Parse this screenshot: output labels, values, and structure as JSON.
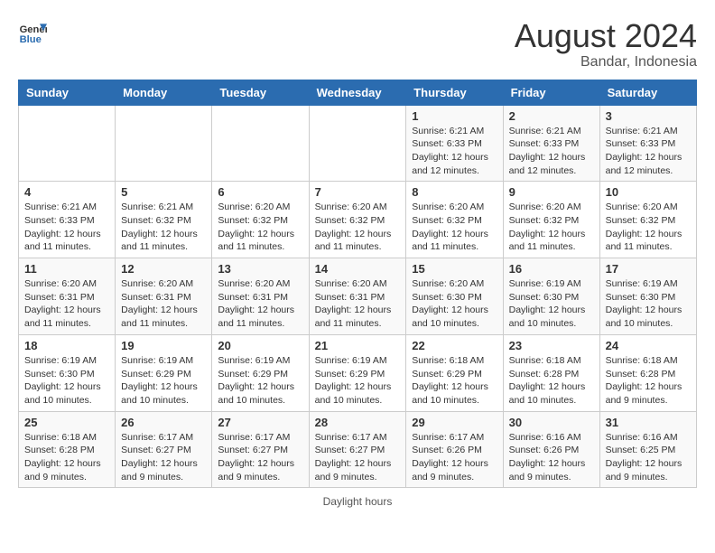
{
  "header": {
    "logo_text_general": "General",
    "logo_text_blue": "Blue",
    "month_year": "August 2024",
    "location": "Bandar, Indonesia"
  },
  "days_of_week": [
    "Sunday",
    "Monday",
    "Tuesday",
    "Wednesday",
    "Thursday",
    "Friday",
    "Saturday"
  ],
  "weeks": [
    [
      {
        "day": "",
        "info": ""
      },
      {
        "day": "",
        "info": ""
      },
      {
        "day": "",
        "info": ""
      },
      {
        "day": "",
        "info": ""
      },
      {
        "day": "1",
        "info": "Sunrise: 6:21 AM\nSunset: 6:33 PM\nDaylight: 12 hours and 12 minutes."
      },
      {
        "day": "2",
        "info": "Sunrise: 6:21 AM\nSunset: 6:33 PM\nDaylight: 12 hours and 12 minutes."
      },
      {
        "day": "3",
        "info": "Sunrise: 6:21 AM\nSunset: 6:33 PM\nDaylight: 12 hours and 12 minutes."
      }
    ],
    [
      {
        "day": "4",
        "info": "Sunrise: 6:21 AM\nSunset: 6:33 PM\nDaylight: 12 hours and 11 minutes."
      },
      {
        "day": "5",
        "info": "Sunrise: 6:21 AM\nSunset: 6:32 PM\nDaylight: 12 hours and 11 minutes."
      },
      {
        "day": "6",
        "info": "Sunrise: 6:20 AM\nSunset: 6:32 PM\nDaylight: 12 hours and 11 minutes."
      },
      {
        "day": "7",
        "info": "Sunrise: 6:20 AM\nSunset: 6:32 PM\nDaylight: 12 hours and 11 minutes."
      },
      {
        "day": "8",
        "info": "Sunrise: 6:20 AM\nSunset: 6:32 PM\nDaylight: 12 hours and 11 minutes."
      },
      {
        "day": "9",
        "info": "Sunrise: 6:20 AM\nSunset: 6:32 PM\nDaylight: 12 hours and 11 minutes."
      },
      {
        "day": "10",
        "info": "Sunrise: 6:20 AM\nSunset: 6:32 PM\nDaylight: 12 hours and 11 minutes."
      }
    ],
    [
      {
        "day": "11",
        "info": "Sunrise: 6:20 AM\nSunset: 6:31 PM\nDaylight: 12 hours and 11 minutes."
      },
      {
        "day": "12",
        "info": "Sunrise: 6:20 AM\nSunset: 6:31 PM\nDaylight: 12 hours and 11 minutes."
      },
      {
        "day": "13",
        "info": "Sunrise: 6:20 AM\nSunset: 6:31 PM\nDaylight: 12 hours and 11 minutes."
      },
      {
        "day": "14",
        "info": "Sunrise: 6:20 AM\nSunset: 6:31 PM\nDaylight: 12 hours and 11 minutes."
      },
      {
        "day": "15",
        "info": "Sunrise: 6:20 AM\nSunset: 6:30 PM\nDaylight: 12 hours and 10 minutes."
      },
      {
        "day": "16",
        "info": "Sunrise: 6:19 AM\nSunset: 6:30 PM\nDaylight: 12 hours and 10 minutes."
      },
      {
        "day": "17",
        "info": "Sunrise: 6:19 AM\nSunset: 6:30 PM\nDaylight: 12 hours and 10 minutes."
      }
    ],
    [
      {
        "day": "18",
        "info": "Sunrise: 6:19 AM\nSunset: 6:30 PM\nDaylight: 12 hours and 10 minutes."
      },
      {
        "day": "19",
        "info": "Sunrise: 6:19 AM\nSunset: 6:29 PM\nDaylight: 12 hours and 10 minutes."
      },
      {
        "day": "20",
        "info": "Sunrise: 6:19 AM\nSunset: 6:29 PM\nDaylight: 12 hours and 10 minutes."
      },
      {
        "day": "21",
        "info": "Sunrise: 6:19 AM\nSunset: 6:29 PM\nDaylight: 12 hours and 10 minutes."
      },
      {
        "day": "22",
        "info": "Sunrise: 6:18 AM\nSunset: 6:29 PM\nDaylight: 12 hours and 10 minutes."
      },
      {
        "day": "23",
        "info": "Sunrise: 6:18 AM\nSunset: 6:28 PM\nDaylight: 12 hours and 10 minutes."
      },
      {
        "day": "24",
        "info": "Sunrise: 6:18 AM\nSunset: 6:28 PM\nDaylight: 12 hours and 9 minutes."
      }
    ],
    [
      {
        "day": "25",
        "info": "Sunrise: 6:18 AM\nSunset: 6:28 PM\nDaylight: 12 hours and 9 minutes."
      },
      {
        "day": "26",
        "info": "Sunrise: 6:17 AM\nSunset: 6:27 PM\nDaylight: 12 hours and 9 minutes."
      },
      {
        "day": "27",
        "info": "Sunrise: 6:17 AM\nSunset: 6:27 PM\nDaylight: 12 hours and 9 minutes."
      },
      {
        "day": "28",
        "info": "Sunrise: 6:17 AM\nSunset: 6:27 PM\nDaylight: 12 hours and 9 minutes."
      },
      {
        "day": "29",
        "info": "Sunrise: 6:17 AM\nSunset: 6:26 PM\nDaylight: 12 hours and 9 minutes."
      },
      {
        "day": "30",
        "info": "Sunrise: 6:16 AM\nSunset: 6:26 PM\nDaylight: 12 hours and 9 minutes."
      },
      {
        "day": "31",
        "info": "Sunrise: 6:16 AM\nSunset: 6:25 PM\nDaylight: 12 hours and 9 minutes."
      }
    ]
  ],
  "footer": {
    "daylight_hours": "Daylight hours"
  }
}
